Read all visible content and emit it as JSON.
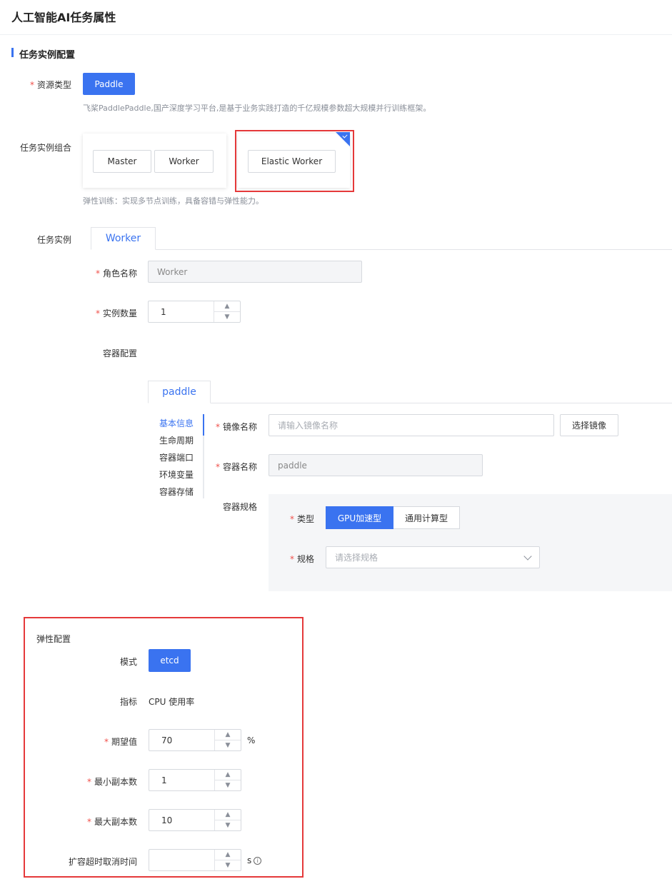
{
  "page": {
    "title": "人工智能AI任务属性"
  },
  "section": {
    "title": "任务实例配置"
  },
  "resource": {
    "label": "资源类型",
    "button": "Paddle",
    "hint": "飞桨PaddlePaddle,国产深度学习平台,是基于业务实践打造的千亿规模参数超大规模并行训练框架。"
  },
  "combo": {
    "label": "任务实例组合",
    "option1": [
      "Master",
      "Worker"
    ],
    "option2": "Elastic Worker",
    "hint": "弹性训练：实现多节点训练，具备容错与弹性能力。"
  },
  "instance": {
    "label": "任务实例",
    "tab": "Worker",
    "role_label": "角色名称",
    "role_value": "Worker",
    "count_label": "实例数量",
    "count_value": "1",
    "container_label": "容器配置"
  },
  "container": {
    "tab": "paddle",
    "nav": [
      "基本信息",
      "生命周期",
      "容器端口",
      "环境变量",
      "容器存储"
    ],
    "image_label": "镜像名称",
    "image_placeholder": "请输入镜像名称",
    "image_button": "选择镜像",
    "name_label": "容器名称",
    "name_value": "paddle",
    "spec_label": "容器规格",
    "type_label": "类型",
    "type_options": [
      "GPU加速型",
      "通用计算型"
    ],
    "size_label": "规格",
    "size_placeholder": "请选择规格"
  },
  "elastic": {
    "title": "弹性配置",
    "mode_label": "模式",
    "mode_value": "etcd",
    "metric_label": "指标",
    "metric_value": "CPU 使用率",
    "expected_label": "期望值",
    "expected_value": "70",
    "expected_unit": "%",
    "min_label": "最小副本数",
    "min_value": "1",
    "max_label": "最大副本数",
    "max_value": "10",
    "timeout_label": "扩容超时取消时间",
    "timeout_value": "",
    "timeout_unit": "s"
  },
  "colors": {
    "accent": "#3a73f0",
    "highlight": "#e5393a",
    "required": "#f0504a"
  }
}
